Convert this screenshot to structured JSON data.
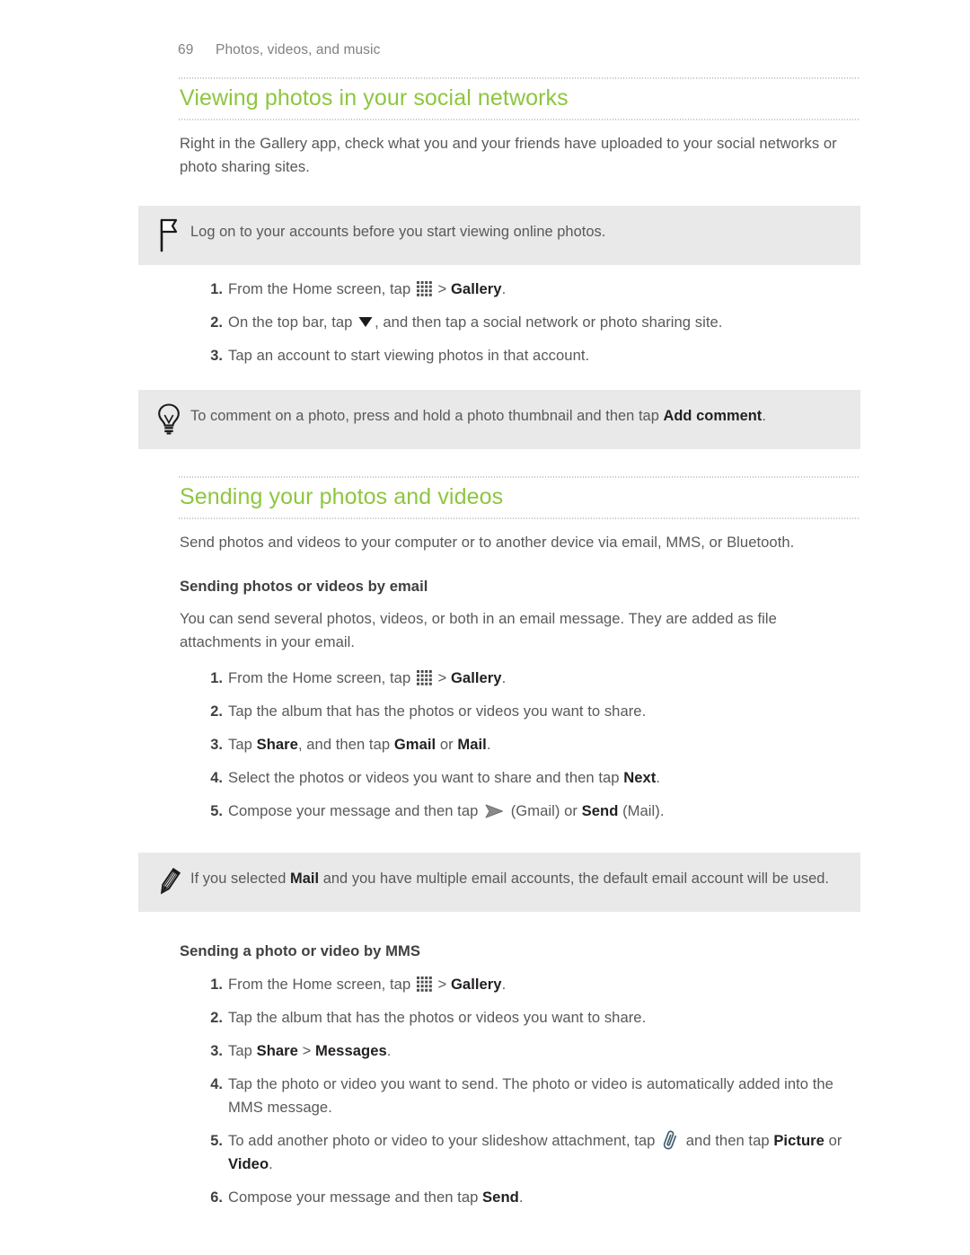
{
  "header": {
    "page_number": "69",
    "chapter": "Photos, videos, and music"
  },
  "theme": {
    "heading_green": "#8dc63f",
    "body_gray": "#58595b",
    "callout_bg": "#e9e9e9",
    "rule_dot": "#9a9a9a",
    "paperclip_blue": "#4a6b80"
  },
  "sections": [
    {
      "id": "viewing-photos",
      "heading": "Viewing photos in your social networks",
      "intro": "Right in the Gallery app, check what you and your friends have uploaded to your social networks or photo sharing sites.",
      "note": {
        "icon": "flag-icon",
        "text": "Log on to your accounts before you start viewing online photos."
      },
      "steps": [
        {
          "parts": [
            {
              "t": "text",
              "v": "From the Home screen, tap "
            },
            {
              "t": "icon",
              "v": "grid-icon"
            },
            {
              "t": "text",
              "v": " > "
            },
            {
              "t": "bold",
              "v": "Gallery"
            },
            {
              "t": "text",
              "v": "."
            }
          ]
        },
        {
          "parts": [
            {
              "t": "text",
              "v": "On the top bar, tap "
            },
            {
              "t": "icon",
              "v": "triangle-down-icon"
            },
            {
              "t": "text",
              "v": ", and then tap a social network or photo sharing site."
            }
          ]
        },
        {
          "parts": [
            {
              "t": "text",
              "v": "Tap an account to start viewing photos in that account."
            }
          ]
        }
      ],
      "tip": {
        "icon": "lightbulb-icon",
        "parts": [
          {
            "t": "text",
            "v": "To comment on a photo, press and hold a photo thumbnail and then tap "
          },
          {
            "t": "bold",
            "v": "Add comment"
          },
          {
            "t": "text",
            "v": "."
          }
        ]
      }
    },
    {
      "id": "sending-photos",
      "heading": "Sending your photos and videos",
      "intro": "Send photos and videos to your computer or to another device via email, MMS, or Bluetooth.",
      "subsections": [
        {
          "id": "by-email",
          "subheading": "Sending photos or videos by email",
          "intro": "You can send several photos, videos, or both in an email message. They are added as file attachments in your email.",
          "steps": [
            {
              "parts": [
                {
                  "t": "text",
                  "v": "From the Home screen, tap "
                },
                {
                  "t": "icon",
                  "v": "grid-icon"
                },
                {
                  "t": "text",
                  "v": " > "
                },
                {
                  "t": "bold",
                  "v": "Gallery"
                },
                {
                  "t": "text",
                  "v": "."
                }
              ]
            },
            {
              "parts": [
                {
                  "t": "text",
                  "v": "Tap the album that has the photos or videos you want to share."
                }
              ]
            },
            {
              "parts": [
                {
                  "t": "text",
                  "v": "Tap "
                },
                {
                  "t": "bold",
                  "v": "Share"
                },
                {
                  "t": "text",
                  "v": ", and then tap "
                },
                {
                  "t": "bold",
                  "v": "Gmail"
                },
                {
                  "t": "text",
                  "v": " or "
                },
                {
                  "t": "bold",
                  "v": "Mail"
                },
                {
                  "t": "text",
                  "v": "."
                }
              ]
            },
            {
              "parts": [
                {
                  "t": "text",
                  "v": "Select the photos or videos you want to share and then tap "
                },
                {
                  "t": "bold",
                  "v": "Next"
                },
                {
                  "t": "text",
                  "v": "."
                }
              ]
            },
            {
              "parts": [
                {
                  "t": "text",
                  "v": "Compose your message and then tap "
                },
                {
                  "t": "icon",
                  "v": "send-arrow-icon"
                },
                {
                  "t": "text",
                  "v": " (Gmail) or "
                },
                {
                  "t": "bold",
                  "v": "Send"
                },
                {
                  "t": "text",
                  "v": " (Mail)."
                }
              ]
            }
          ],
          "note": {
            "icon": "pencil-icon",
            "parts": [
              {
                "t": "text",
                "v": "If you selected "
              },
              {
                "t": "bold",
                "v": "Mail"
              },
              {
                "t": "text",
                "v": " and you have multiple email accounts, the default email account will be used."
              }
            ]
          }
        },
        {
          "id": "by-mms",
          "subheading": "Sending a photo or video by MMS",
          "steps": [
            {
              "parts": [
                {
                  "t": "text",
                  "v": "From the Home screen, tap "
                },
                {
                  "t": "icon",
                  "v": "grid-icon"
                },
                {
                  "t": "text",
                  "v": " > "
                },
                {
                  "t": "bold",
                  "v": "Gallery"
                },
                {
                  "t": "text",
                  "v": "."
                }
              ]
            },
            {
              "parts": [
                {
                  "t": "text",
                  "v": "Tap the album that has the photos or videos you want to share."
                }
              ]
            },
            {
              "parts": [
                {
                  "t": "text",
                  "v": "Tap "
                },
                {
                  "t": "bold",
                  "v": "Share"
                },
                {
                  "t": "text",
                  "v": " > "
                },
                {
                  "t": "bold",
                  "v": "Messages"
                },
                {
                  "t": "text",
                  "v": "."
                }
              ]
            },
            {
              "parts": [
                {
                  "t": "text",
                  "v": "Tap the photo or video you want to send. The photo or video is automatically added into the MMS message."
                }
              ]
            },
            {
              "parts": [
                {
                  "t": "text",
                  "v": "To add another photo or video to your slideshow attachment, tap "
                },
                {
                  "t": "icon",
                  "v": "paperclip-icon"
                },
                {
                  "t": "text",
                  "v": " and then tap "
                },
                {
                  "t": "bold",
                  "v": "Picture"
                },
                {
                  "t": "text",
                  "v": " or "
                },
                {
                  "t": "bold",
                  "v": "Video"
                },
                {
                  "t": "text",
                  "v": "."
                }
              ]
            },
            {
              "parts": [
                {
                  "t": "text",
                  "v": "Compose your message and then tap "
                },
                {
                  "t": "bold",
                  "v": "Send"
                },
                {
                  "t": "text",
                  "v": "."
                }
              ]
            }
          ]
        }
      ]
    }
  ]
}
